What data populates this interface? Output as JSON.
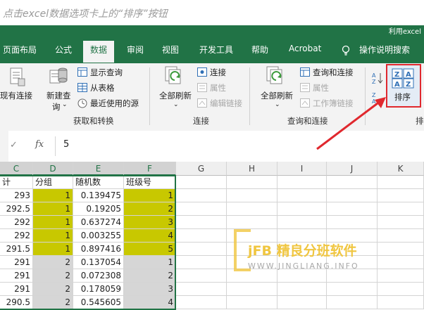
{
  "banner": {
    "instruction": "点击excel数据选项卡上的“排序”按钮"
  },
  "titlebar": {
    "title": "利用excel"
  },
  "tabs": [
    {
      "label": "页面布局",
      "active": false
    },
    {
      "label": "公式",
      "active": false
    },
    {
      "label": "数据",
      "active": true
    },
    {
      "label": "审阅",
      "active": false
    },
    {
      "label": "视图",
      "active": false
    },
    {
      "label": "开发工具",
      "active": false
    },
    {
      "label": "帮助",
      "active": false
    },
    {
      "label": "Acrobat",
      "active": false
    },
    {
      "label": "操作说明搜索",
      "active": false
    }
  ],
  "ribbon": {
    "existing_connections": "现有连接",
    "new_query_line1": "新建查",
    "new_query_line2": "询",
    "show_queries": "显示查询",
    "from_table": "从表格",
    "recent_sources": "最近使用的源",
    "group_get_transform": "获取和转换",
    "refresh_all_1": "全部刷新",
    "connections": "连接",
    "properties": "属性",
    "edit_links": "编辑链接",
    "group_connections": "连接",
    "refresh_all_2": "全部刷新",
    "queries_connections": "查询和连接",
    "properties_2": "属性",
    "workbook_links": "工作簿链接",
    "group_queries_connections": "查询和连接",
    "sort_az_icon": "A↓Z",
    "sort": "排序",
    "group_sort_partial": "排"
  },
  "formula_bar": {
    "value": "5",
    "fx": "fx"
  },
  "columns": [
    "C",
    "D",
    "E",
    "F",
    "G",
    "H",
    "I",
    "J",
    "K"
  ],
  "headers": {
    "c": "计",
    "d": "分组",
    "e": "随机数",
    "f": "班级号"
  },
  "rows": [
    {
      "c": "293",
      "d": "1",
      "e": "0.139475",
      "f": "1",
      "hl": "yellow"
    },
    {
      "c": "292.5",
      "d": "1",
      "e": "0.19205",
      "f": "2",
      "hl": "yellow"
    },
    {
      "c": "292",
      "d": "1",
      "e": "0.637274",
      "f": "3",
      "hl": "yellow"
    },
    {
      "c": "292",
      "d": "1",
      "e": "0.003255",
      "f": "4",
      "hl": "yellow"
    },
    {
      "c": "291.5",
      "d": "1",
      "e": "0.897416",
      "f": "5",
      "hl": "yellow"
    },
    {
      "c": "291",
      "d": "2",
      "e": "0.137054",
      "f": "1",
      "hl": "gray"
    },
    {
      "c": "291",
      "d": "2",
      "e": "0.072308",
      "f": "2",
      "hl": "gray"
    },
    {
      "c": "291",
      "d": "2",
      "e": "0.178059",
      "f": "3",
      "hl": "gray"
    },
    {
      "c": "290.5",
      "d": "2",
      "e": "0.545605",
      "f": "4",
      "hl": "gray"
    }
  ],
  "watermark": {
    "brand": "jFB 精良分班软件",
    "url": "WWW.JINGLIANG.INFO"
  },
  "colors": {
    "excel_green": "#217346",
    "highlight_red": "#e0282e",
    "yellow_fill": "#c8c800",
    "gray_fill": "#d6d6d6"
  }
}
